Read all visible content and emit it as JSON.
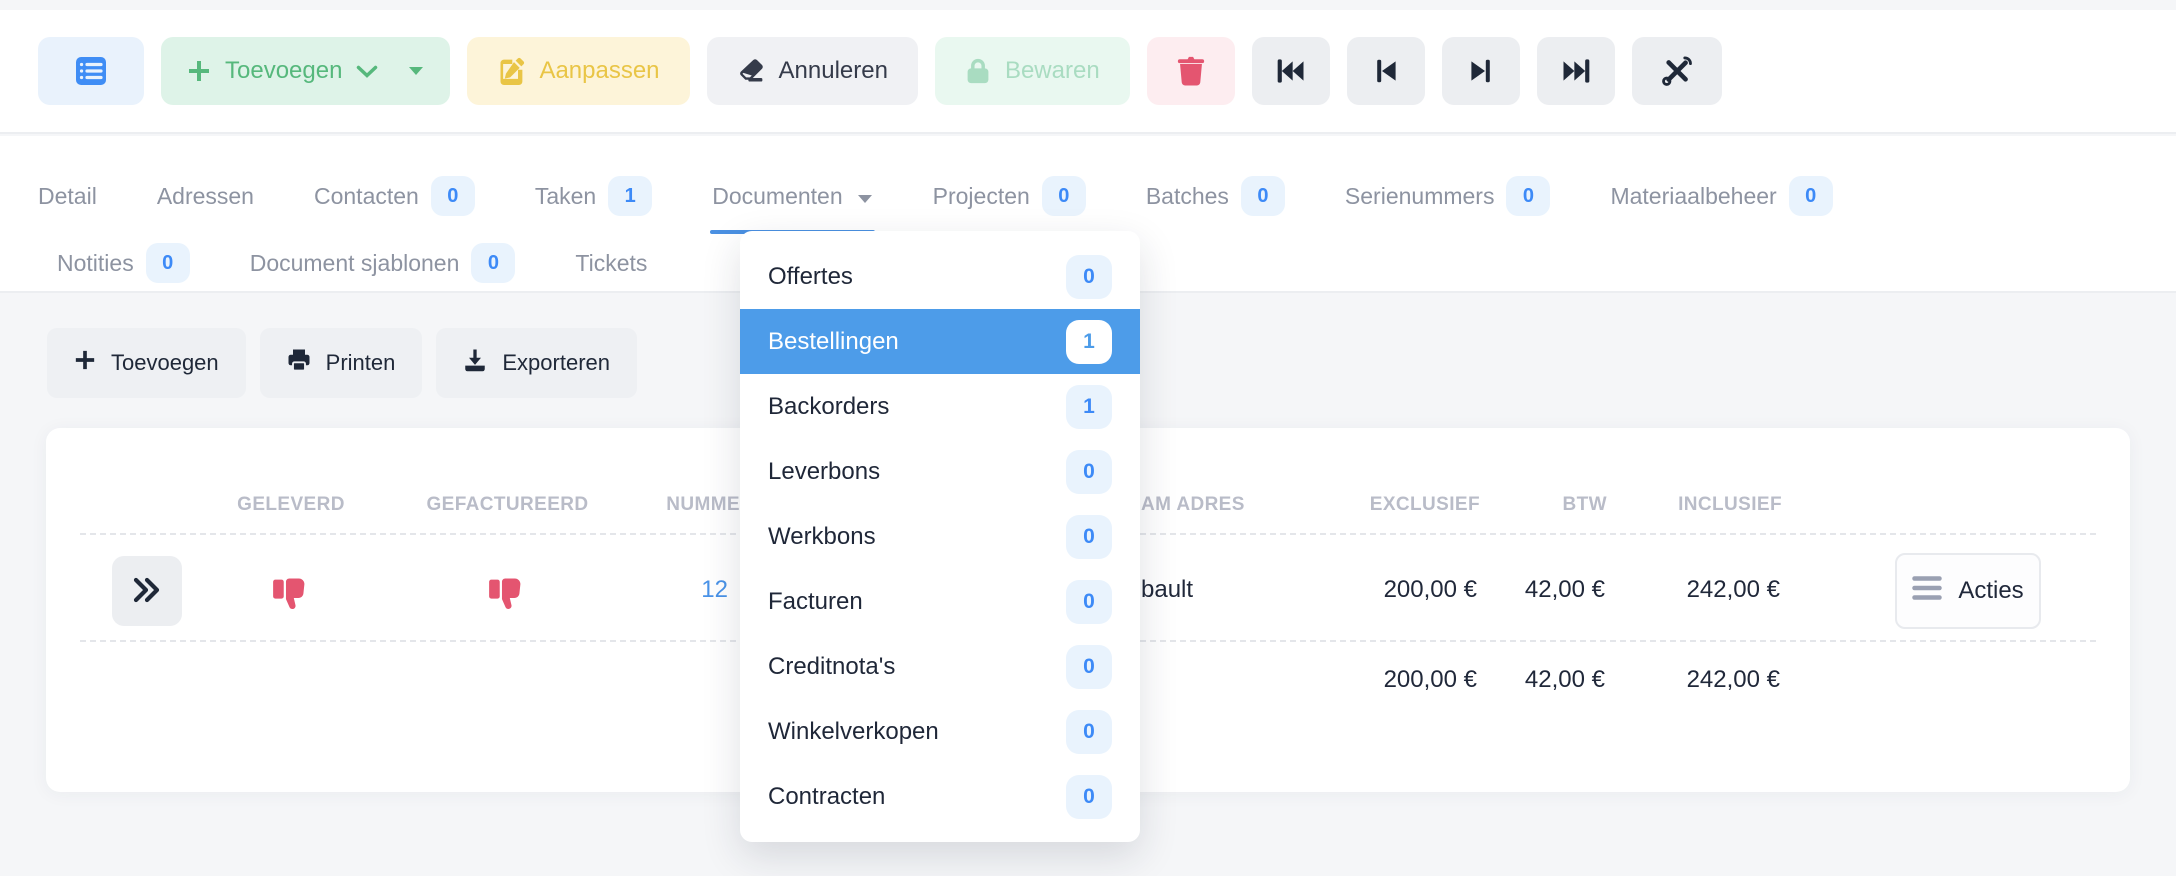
{
  "colors": {
    "accent_blue": "#3d8af7",
    "selected_blue": "#4d9ce9",
    "green": "#56b87c",
    "yellow": "#e9c546",
    "red": "#e45570",
    "dark_text": "#232b3e"
  },
  "main_toolbar": {
    "toevoegen": "Toevoegen",
    "aanpassen": "Aanpassen",
    "annuleren": "Annuleren",
    "bewaren": "Bewaren"
  },
  "tabs": {
    "row1": [
      {
        "label": "Detail"
      },
      {
        "label": "Adressen"
      },
      {
        "label": "Contacten",
        "count": "0"
      },
      {
        "label": "Taken",
        "count": "1"
      },
      {
        "label": "Documenten",
        "active": true
      },
      {
        "label": "Projecten",
        "count": "0"
      },
      {
        "label": "Batches",
        "count": "0"
      },
      {
        "label": "Serienummers",
        "count": "0"
      },
      {
        "label": "Materiaalbeheer",
        "count": "0"
      }
    ],
    "row2": [
      {
        "label": "Notities",
        "count": "0"
      },
      {
        "label": "Document sjablonen",
        "count": "0"
      },
      {
        "label": "Tickets"
      }
    ]
  },
  "documenten_menu": [
    {
      "label": "Offertes",
      "count": "0"
    },
    {
      "label": "Bestellingen",
      "count": "1",
      "selected": true
    },
    {
      "label": "Backorders",
      "count": "1"
    },
    {
      "label": "Leverbons",
      "count": "0"
    },
    {
      "label": "Werkbons",
      "count": "0"
    },
    {
      "label": "Facturen",
      "count": "0"
    },
    {
      "label": "Creditnota's",
      "count": "0"
    },
    {
      "label": "Winkelverkopen",
      "count": "0"
    },
    {
      "label": "Contracten",
      "count": "0"
    }
  ],
  "list_toolbar": {
    "toevoegen": "Toevoegen",
    "printen": "Printen",
    "exporteren": "Exporteren"
  },
  "table": {
    "headers": {
      "geleverd": "GELEVERD",
      "gefactureerd": "GEFACTUREERD",
      "nummer": "NUMME",
      "naam_adres": "AM ADRES",
      "exclusief": "EXCLUSIEF",
      "btw": "BTW",
      "inclusief": "INCLUSIEF"
    },
    "row": {
      "nummer": "12",
      "naam_adres": "bault",
      "exclusief": "200,00 €",
      "btw": "42,00 €",
      "inclusief": "242,00 €",
      "acties": "Acties"
    },
    "totals": {
      "exclusief": "200,00 €",
      "btw": "42,00 €",
      "inclusief": "242,00 €"
    }
  }
}
